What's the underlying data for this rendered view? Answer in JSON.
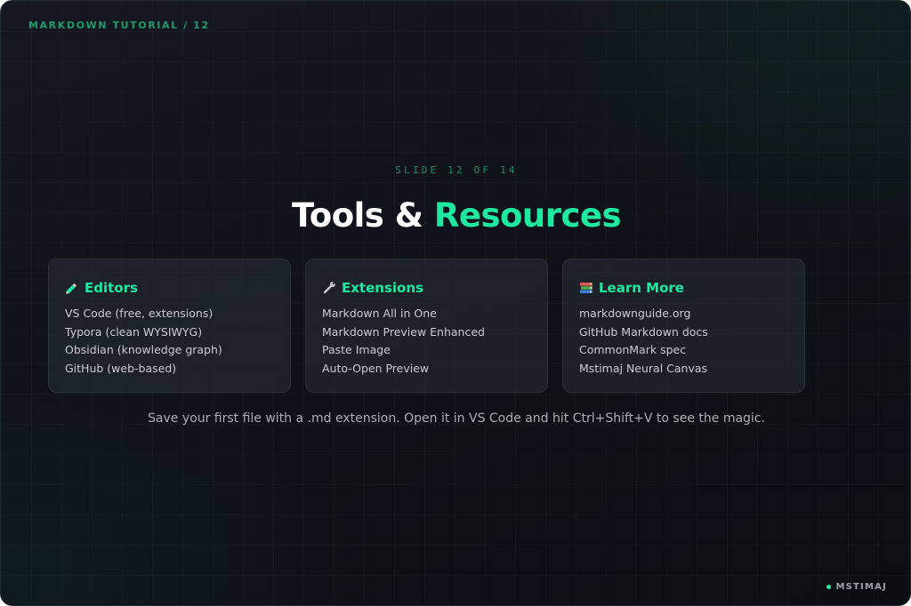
{
  "header": {
    "topic_label": "MARKDOWN TUTORIAL / 12"
  },
  "slide": {
    "counter": "SLIDE 12 OF 14",
    "title_main": "Tools &",
    "title_accent": "Resources",
    "tip": "Save your first file with a .md extension. Open it in VS Code and hit Ctrl+Shift+V to see the magic."
  },
  "cards": [
    {
      "icon": "pencil-icon",
      "title": "Editors",
      "items": [
        "VS Code (free, extensions)",
        "Typora (clean WYSIWYG)",
        "Obsidian (knowledge graph)",
        "GitHub (web-based)"
      ]
    },
    {
      "icon": "wrench-icon",
      "title": "Extensions",
      "items": [
        "Markdown All in One",
        "Markdown Preview Enhanced",
        "Paste Image",
        "Auto-Open Preview"
      ]
    },
    {
      "icon": "books-icon",
      "title": "Learn More",
      "items": [
        "markdownguide.org",
        "GitHub Markdown docs",
        "CommonMark spec",
        "Mstimaj Neural Canvas"
      ]
    }
  ],
  "footer": {
    "brand": "MSTIMAJ"
  },
  "colors": {
    "accent": "#1de9a0",
    "background": "#0f1319",
    "card_bg": "#252b34",
    "text": "#c9cdd2"
  }
}
